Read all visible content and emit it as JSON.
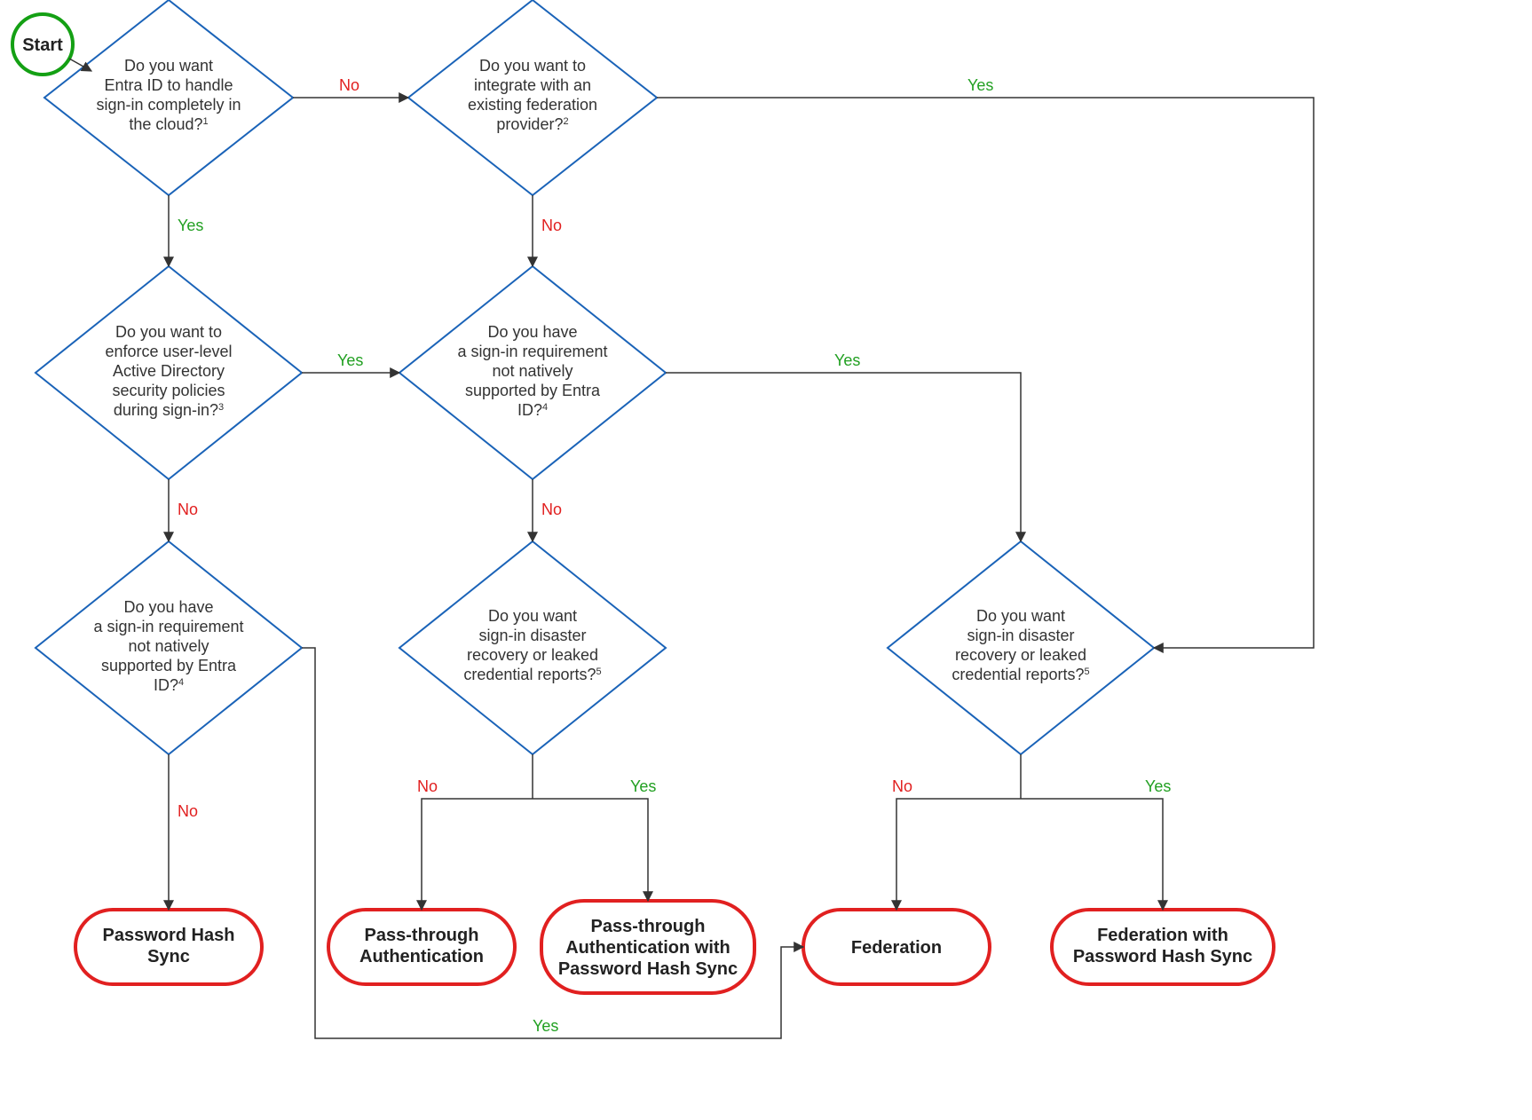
{
  "start": {
    "label": "Start"
  },
  "decisions": {
    "d1": {
      "line1": "Do you want",
      "line2": "Entra ID to handle",
      "line3": "sign-in completely in",
      "line4": "the cloud?",
      "sup": "1"
    },
    "d2": {
      "line1": "Do you want to",
      "line2": "integrate with an",
      "line3": "existing federation",
      "line4": "provider?",
      "sup": "2"
    },
    "d3": {
      "line1": "Do you want to",
      "line2": "enforce user-level",
      "line3": "Active Directory",
      "line4": "security policies",
      "line5": "during sign-in?",
      "sup": "3"
    },
    "d4": {
      "line1": "Do you have",
      "line2": "a sign-in requirement",
      "line3": "not natively",
      "line4": "supported by Entra",
      "line5": "ID?",
      "sup": "4"
    },
    "d5": {
      "line1": "Do you have",
      "line2": "a sign-in requirement",
      "line3": "not natively",
      "line4": "supported by Entra",
      "line5": "ID?",
      "sup": "4"
    },
    "d6": {
      "line1": "Do you want",
      "line2": "sign-in disaster",
      "line3": "recovery or leaked",
      "line4": "credential reports?",
      "sup": "5"
    },
    "d7": {
      "line1": "Do you want",
      "line2": "sign-in disaster",
      "line3": "recovery or leaked",
      "line4": "credential reports?",
      "sup": "5"
    }
  },
  "endpoints": {
    "e1": {
      "line1": "Password Hash",
      "line2": "Sync"
    },
    "e2": {
      "line1": "Pass-through",
      "line2": "Authentication"
    },
    "e3": {
      "line1": "Pass-through",
      "line2": "Authentication with",
      "line3": "Password Hash Sync"
    },
    "e4": {
      "line1": "Federation"
    },
    "e5": {
      "line1": "Federation with",
      "line2": "Password Hash Sync"
    }
  },
  "edgeLabels": {
    "d1_no": "No",
    "d1_yes": "Yes",
    "d2_yes": "Yes",
    "d2_no": "No",
    "d3_yes": "Yes",
    "d3_no": "No",
    "d4_yes": "Yes",
    "d4_no": "No",
    "d5_no": "No",
    "d5_yes": "Yes",
    "d6_no": "No",
    "d6_yes": "Yes",
    "d7_no": "No",
    "d7_yes": "Yes"
  }
}
